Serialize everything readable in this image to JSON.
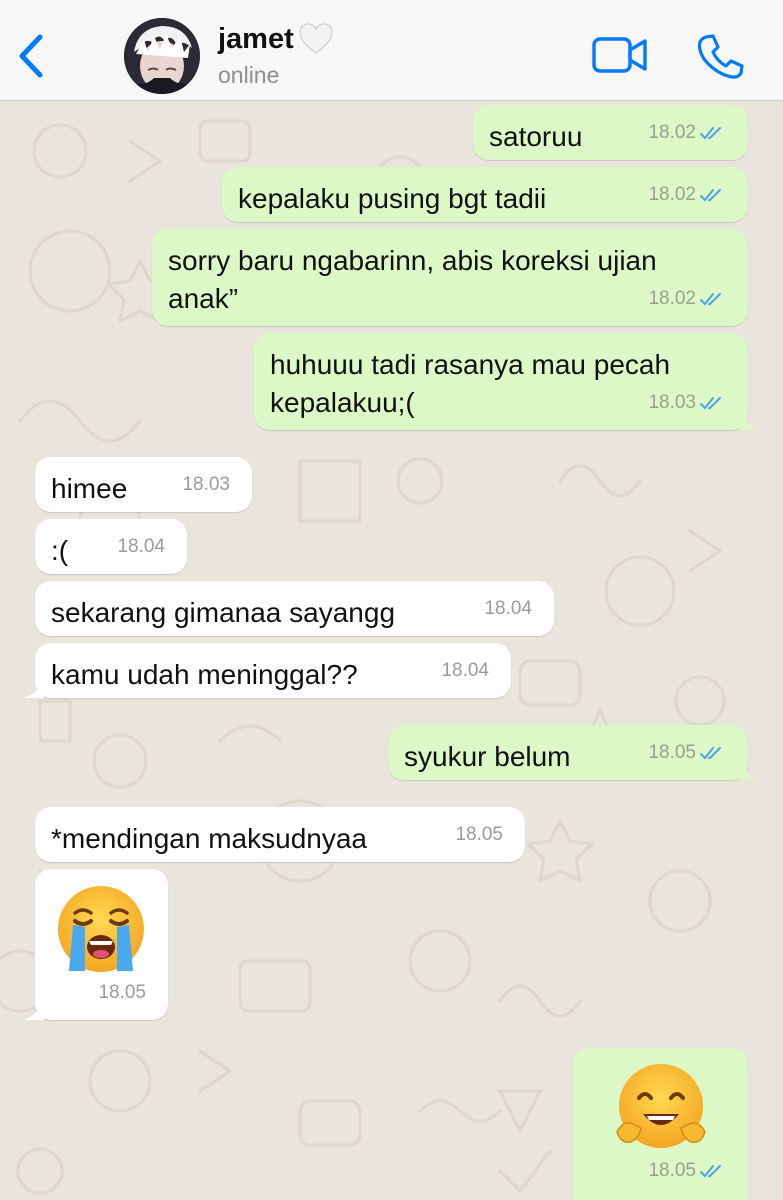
{
  "header": {
    "contact_name": "jamet",
    "status": "online",
    "back_icon": "chevron-left-icon",
    "video_icon": "video-camera-icon",
    "call_icon": "phone-icon",
    "accent_color": "#007aff"
  },
  "messages": [
    {
      "direction": "outgoing",
      "text": "satoruu",
      "time": "18.02",
      "receipt": "read"
    },
    {
      "direction": "outgoing",
      "text": "kepalaku pusing bgt tadii",
      "time": "18.02",
      "receipt": "read"
    },
    {
      "direction": "outgoing",
      "text_line1": "sorry baru ngabarinn, abis koreksi ujian",
      "text_line2": "anak”",
      "time": "18.02",
      "receipt": "read"
    },
    {
      "direction": "outgoing",
      "text_line1": "huhuuu tadi rasanya mau pecah",
      "text_line2": "kepalakuu;(",
      "time": "18.03",
      "receipt": "read"
    },
    {
      "direction": "incoming",
      "text": "himee",
      "time": "18.03"
    },
    {
      "direction": "incoming",
      "text": ":(",
      "time": "18.04"
    },
    {
      "direction": "incoming",
      "text": "sekarang gimanaa sayangg",
      "time": "18.04"
    },
    {
      "direction": "incoming",
      "text": "kamu udah meninggal??",
      "time": "18.04"
    },
    {
      "direction": "outgoing",
      "text": "syukur belum",
      "time": "18.05",
      "receipt": "read"
    },
    {
      "direction": "incoming",
      "text": "*mendingan maksudnyaa",
      "time": "18.05"
    },
    {
      "direction": "incoming",
      "emoji": "loudly-crying-face-emoji",
      "time": "18.05"
    },
    {
      "direction": "outgoing",
      "emoji": "hugging-face-emoji",
      "time": "18.05",
      "receipt": "read"
    }
  ],
  "colors": {
    "outgoing_bubble": "#dcf8c6",
    "incoming_bubble": "#ffffff",
    "wallpaper": "#e9e4dc",
    "read_tick": "#4fa3e0"
  }
}
